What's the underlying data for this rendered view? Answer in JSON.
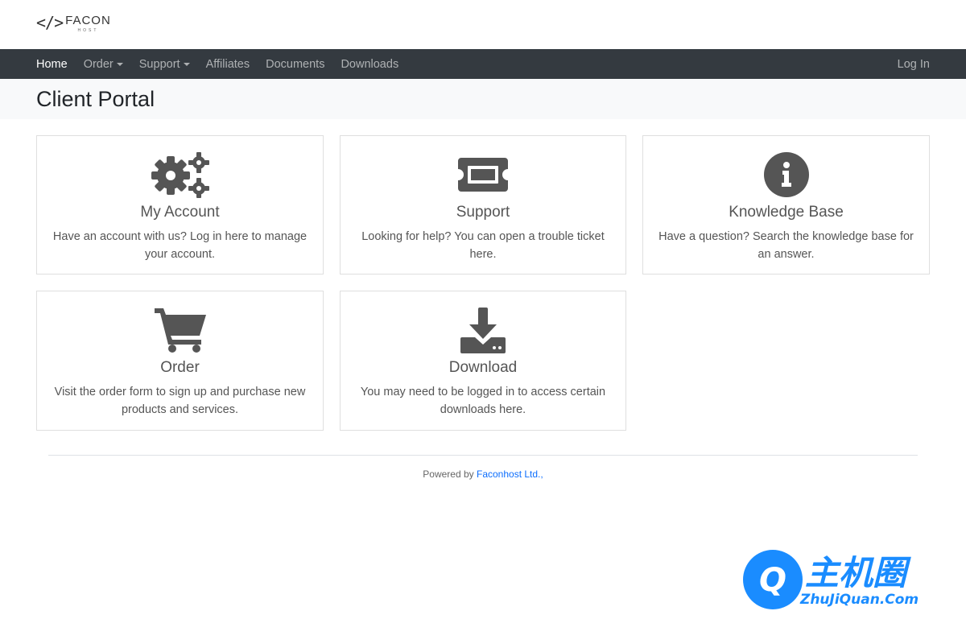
{
  "brand": {
    "mark": "</>",
    "name": "FACON",
    "sub": "HOST"
  },
  "nav": {
    "items": [
      {
        "label": "Home",
        "active": true
      },
      {
        "label": "Order",
        "dropdown": true
      },
      {
        "label": "Support",
        "dropdown": true
      },
      {
        "label": "Affiliates"
      },
      {
        "label": "Documents"
      },
      {
        "label": "Downloads"
      }
    ],
    "login": "Log In"
  },
  "page": {
    "title": "Client Portal"
  },
  "cards": [
    {
      "icon": "cogs-icon",
      "title": "My Account",
      "text": "Have an account with us? Log in here to manage your account."
    },
    {
      "icon": "ticket-icon",
      "title": "Support",
      "text": "Looking for help? You can open a trouble ticket here."
    },
    {
      "icon": "info-circle-icon",
      "title": "Knowledge Base",
      "text": "Have a question? Search the knowledge base for an answer."
    },
    {
      "icon": "shopping-cart-icon",
      "title": "Order",
      "text": "Visit the order form to sign up and purchase new products and services."
    },
    {
      "icon": "download-icon",
      "title": "Download",
      "text": "You may need to be logged in to access certain downloads here."
    }
  ],
  "footer": {
    "prefix": "Powered by",
    "link": "Faconhost Ltd.,"
  },
  "watermark": {
    "char": "Q",
    "cn": "主机圈",
    "en": "ZhuJiQuan.Com"
  },
  "colors": {
    "navbar": "#343a40",
    "icon": "#555555",
    "link": "#0d6efd",
    "watermark": "#1a8cff"
  }
}
